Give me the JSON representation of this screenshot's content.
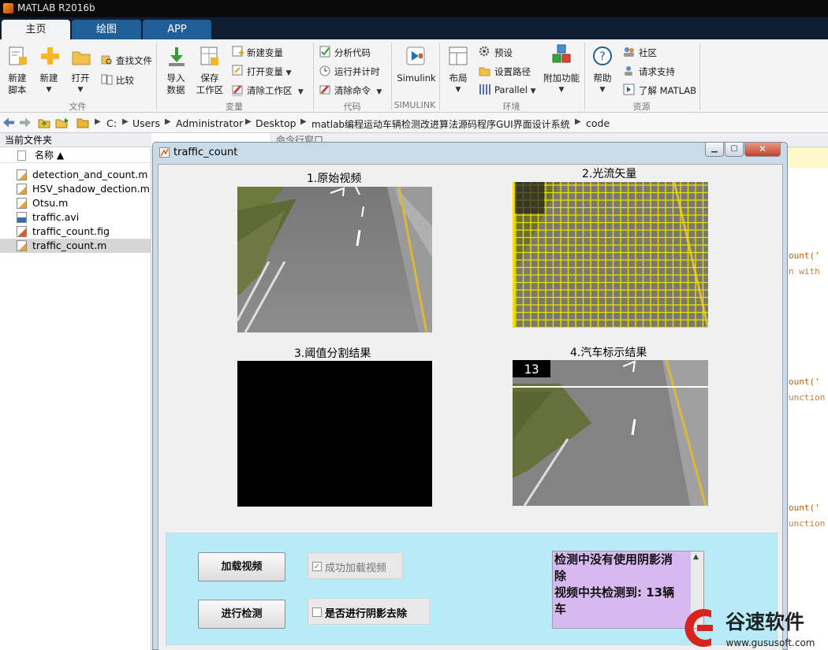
{
  "app": {
    "title": "MATLAB R2016b"
  },
  "tabs": [
    "主页",
    "绘图",
    "APP"
  ],
  "ribbon": {
    "file": {
      "new_script": [
        "新建",
        "脚本"
      ],
      "new": "新建",
      "open": "打开",
      "find_files": "查找文件",
      "compare": "比较",
      "group": "文件"
    },
    "variable": {
      "import": [
        "导入",
        "数据"
      ],
      "save": [
        "保存",
        "工作区"
      ],
      "new_var": "新建变量",
      "open_var": "打开变量",
      "clear_ws": "清除工作区",
      "group": "变量"
    },
    "code": {
      "analyze": "分析代码",
      "run_time": "运行并计时",
      "clear_cmd": "清除命令",
      "group": "代码"
    },
    "simulink": {
      "label": "Simulink",
      "group": "SIMULINK"
    },
    "environment": {
      "layout": "布局",
      "prefs": "预设",
      "set_path": "设置路径",
      "parallel": "Parallel",
      "addons": "附加功能",
      "group": "环境"
    },
    "resources": {
      "help": "帮助",
      "community": "社区",
      "support": "请求支持",
      "learn": "了解 MATLAB",
      "group": "资源"
    }
  },
  "address": {
    "path": [
      "C:",
      "Users",
      "Administrator",
      "Desktop",
      "matlab编程运动车辆检测改进算法源码程序GUI界面设计系统",
      "code"
    ]
  },
  "current_folder": {
    "title": "当前文件夹",
    "col_name": "名称 ▲",
    "files": [
      "detection_and_count.m",
      "HSV_shadow_dection.m",
      "Otsu.m",
      "traffic.avi",
      "traffic_count.fig",
      "traffic_count.m"
    ],
    "selected": "traffic_count.m"
  },
  "background": {
    "cmd_title": "命令行窗口",
    "code_frag1": "ount('",
    "code_frag2": "n with",
    "code_frag3": "unction"
  },
  "gui": {
    "title": "traffic_count",
    "panels": {
      "p1": "1.原始视频",
      "p2": "2.光流矢量",
      "p3": "3.阈值分割结果",
      "p4": "4.汽车标示结果"
    },
    "car_count_overlay": "13",
    "load_button": "加载视频",
    "detect_button": "进行检测",
    "load_success_checkbox": {
      "label": "成功加载视频",
      "checked": true
    },
    "shadow_checkbox": {
      "label": "是否进行阴影去除",
      "checked": false
    },
    "result_text": [
      "检测中没有使用阴影消",
      "除",
      "视频中共检测到: 13辆",
      "车"
    ]
  },
  "watermark": {
    "brand": "谷速软件",
    "url": "www.gususoft.com"
  },
  "colors": {
    "accent": "#1f5e97",
    "ctrl_panel": "#b8ebf8",
    "result_box": "#d8b8f0",
    "grid": "#f0e000"
  }
}
